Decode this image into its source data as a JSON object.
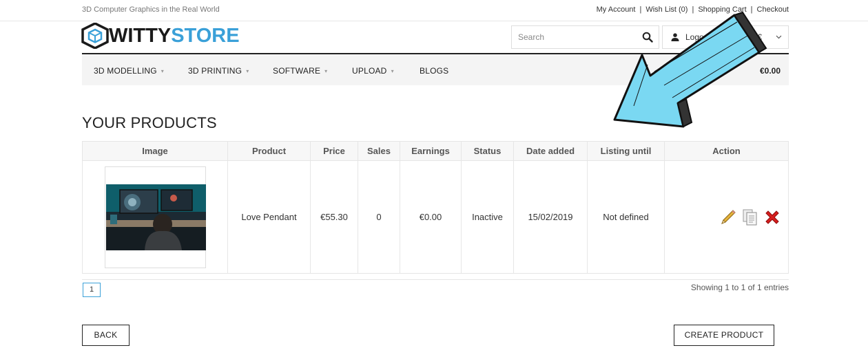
{
  "header": {
    "tagline": "3D Computer Graphics in the Real World",
    "links": [
      "My Account",
      "Wish List (0)",
      "Shopping Cart",
      "Checkout"
    ],
    "separator": "|"
  },
  "logo": {
    "part1": "WITTY",
    "part2": "STORE"
  },
  "search": {
    "placeholder": "Search"
  },
  "account": {
    "label": "Logout",
    "currency": "€"
  },
  "nav": {
    "items": [
      "3D MODELLING",
      "3D PRINTING",
      "SOFTWARE",
      "UPLOAD",
      "BLOGS"
    ],
    "caret": "▾",
    "cart_total": "€0.00"
  },
  "page_title": "YOUR PRODUCTS",
  "table": {
    "headers": [
      "Image",
      "Product",
      "Price",
      "Sales",
      "Earnings",
      "Status",
      "Date added",
      "Listing until",
      "Action"
    ],
    "rows": [
      {
        "product": "Love Pendant",
        "price": "€55.30",
        "sales": "0",
        "earnings": "€0.00",
        "status": "Inactive",
        "date_added": "15/02/2019",
        "listing_until": "Not defined"
      }
    ]
  },
  "pagination": {
    "current_page": "1",
    "summary": "Showing 1 to 1 of 1 entries"
  },
  "buttons": {
    "back": "BACK",
    "create": "CREATE PRODUCT"
  },
  "colors": {
    "accent": "#3aa0d8",
    "status_inactive": "#b50d0d",
    "arrow": "#7ad8f2"
  }
}
